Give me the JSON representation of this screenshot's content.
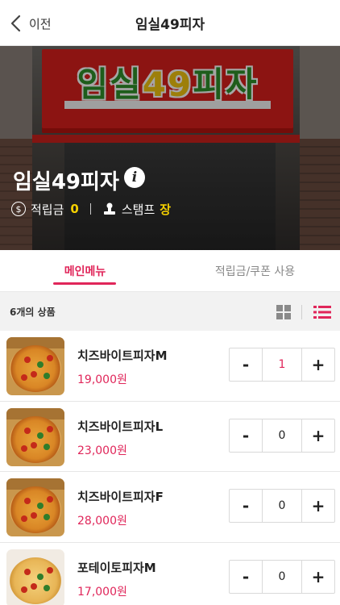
{
  "header": {
    "back_label": "이전",
    "title": "임실49피자",
    "back_icon": "chevron-left-icon"
  },
  "hero": {
    "sign_text_a": "임실",
    "sign_text_b": "49",
    "sign_text_c": "피자",
    "store_name": "임실49피자",
    "info_icon": "info-icon",
    "points_label": "적립금",
    "points_value": "0",
    "stamp_label": "스탬프",
    "stamp_value": "장"
  },
  "tabs": [
    {
      "label": "메인메뉴",
      "active": true
    },
    {
      "label": "적립금/쿠폰 사용",
      "active": false
    }
  ],
  "list_header": {
    "count_text": "6개의 상품",
    "grid_icon": "grid-view-icon",
    "list_icon": "list-view-icon"
  },
  "products": [
    {
      "name": "치즈바이트피자M",
      "price": "19,000원",
      "qty": "1",
      "minus": "-",
      "plus": "+"
    },
    {
      "name": "치즈바이트피자L",
      "price": "23,000원",
      "qty": "0",
      "minus": "-",
      "plus": "+"
    },
    {
      "name": "치즈바이트피자F",
      "price": "28,000원",
      "qty": "0",
      "minus": "-",
      "plus": "+"
    },
    {
      "name": "포테이토피자M",
      "price": "17,000원",
      "qty": "0",
      "minus": "-",
      "plus": "+"
    }
  ],
  "colors": {
    "accent": "#e0265a",
    "highlight": "#f5d000",
    "sign_red": "#d8201c"
  }
}
